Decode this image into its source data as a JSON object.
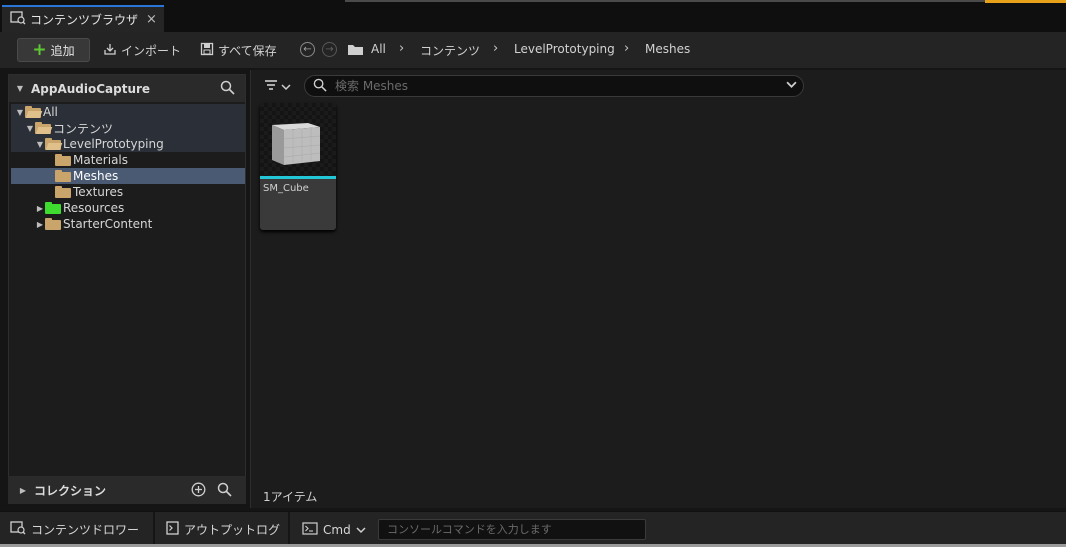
{
  "tab": {
    "label": "コンテンツブラウザ",
    "close": "×"
  },
  "toolbar": {
    "add_label": "追加",
    "import_label": "インポート",
    "save_all_label": "すべて保存",
    "breadcrumb": [
      "All",
      "コンテンツ",
      "LevelPrototyping",
      "Meshes"
    ]
  },
  "sources": {
    "title": "AppAudioCapture",
    "tree": [
      {
        "label": "All",
        "depth": 0,
        "expanded": true
      },
      {
        "label": "コンテンツ",
        "depth": 1,
        "expanded": true
      },
      {
        "label": "LevelPrototyping",
        "depth": 2,
        "expanded": true
      },
      {
        "label": "Materials",
        "depth": 3
      },
      {
        "label": "Meshes",
        "depth": 3,
        "selected": true
      },
      {
        "label": "Textures",
        "depth": 3
      },
      {
        "label": "Resources",
        "depth": 2,
        "collapsed": true,
        "color": "#3ddc2f"
      },
      {
        "label": "StarterContent",
        "depth": 2,
        "collapsed": true
      }
    ],
    "collections_label": "コレクション"
  },
  "browser": {
    "search_placeholder": "検索 Meshes",
    "assets": [
      {
        "name": "SM_Cube"
      }
    ],
    "item_count": "1アイテム"
  },
  "bottom": {
    "content_drawer": "コンテンツドロワー",
    "output_log": "アウトプットログ",
    "cmd_label": "Cmd",
    "console_placeholder": "コンソールコマンドを入力します"
  },
  "colors": {
    "accent_tab": "#2a75d8",
    "folder": "#c9a56b",
    "asset_bar": "#23c7d8",
    "add_plus": "#5ec832"
  }
}
